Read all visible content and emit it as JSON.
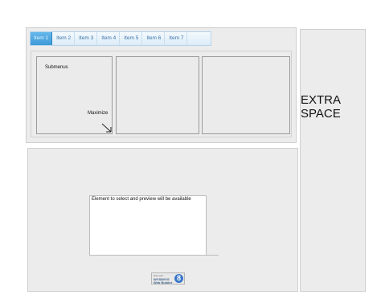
{
  "tabs": [
    "Item 1",
    "Item 2",
    "Item 3",
    "Item 4",
    "Item 5",
    "Item 6",
    "Item 7"
  ],
  "box1": {
    "submenus_label": "Submenus",
    "maximize_label": "Maximize"
  },
  "extra": {
    "line1": "EXTRA",
    "line2": "SPACE"
  },
  "preview": {
    "text": "Element to select and preview will be available"
  },
  "badge": {
    "line1": "Built with",
    "line2": "WYSIWYG",
    "line3": "Web Builder",
    "number": "8"
  }
}
